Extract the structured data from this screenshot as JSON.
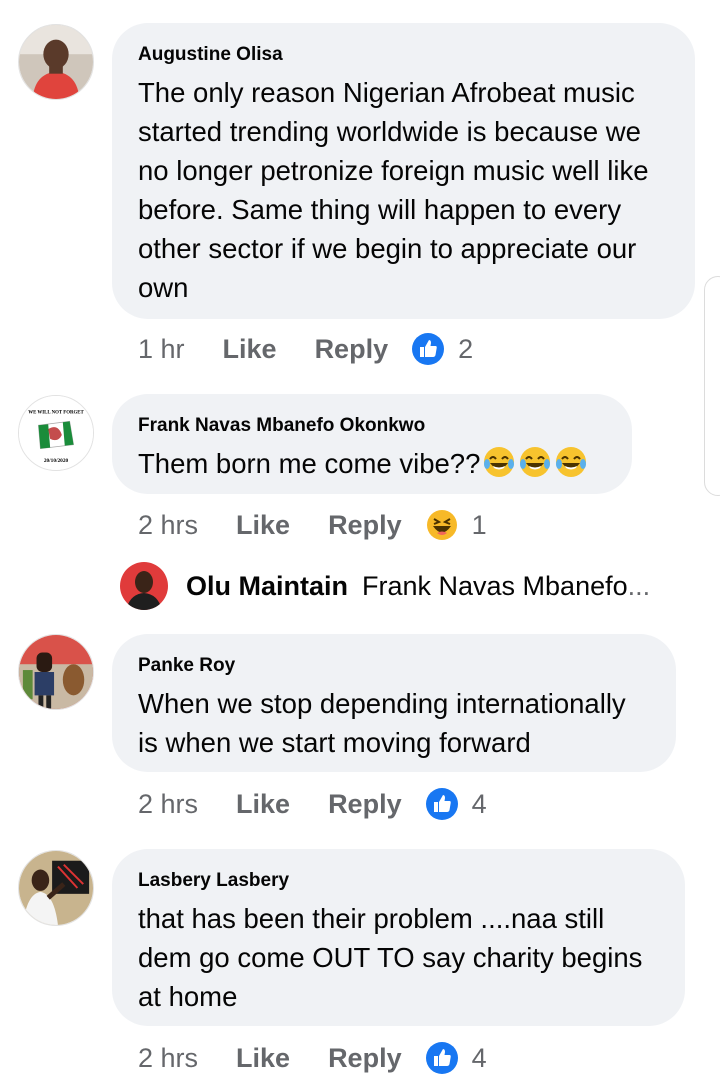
{
  "comments": [
    {
      "author": "Augustine Olisa",
      "text": "The only reason Nigerian Afrobeat music started trending worldwide is because we no longer petronize foreign music well like before. Same thing will happen to every other sector if we begin to appreciate our own",
      "time": "1 hr",
      "like_label": "Like",
      "reply_label": "Reply",
      "reaction": "like-icon",
      "reaction_count": "2"
    },
    {
      "author": "Frank Navas Mbanefo Okonkwo",
      "text": "Them born me come vibe??",
      "emojis": [
        "laughing-tears-emoji",
        "laughing-tears-emoji",
        "laughing-tears-emoji"
      ],
      "avatar_text_top": "WE WILL NOT FORGET",
      "avatar_text_bottom": "20/10/2020",
      "time": "2 hrs",
      "like_label": "Like",
      "reply_label": "Reply",
      "reaction": "haha-icon",
      "reaction_count": "1"
    },
    {
      "author": "Panke Roy",
      "text": "When we stop depending internationally is when we start moving forward",
      "time": "2 hrs",
      "like_label": "Like",
      "reply_label": "Reply",
      "reaction": "like-icon",
      "reaction_count": "4"
    },
    {
      "author": "Lasbery Lasbery",
      "text": "that has been their problem ....naa still dem go come OUT TO say charity begins at home",
      "time": "2 hrs",
      "like_label": "Like",
      "reply_label": "Reply",
      "reaction": "like-icon",
      "reaction_count": "4"
    }
  ],
  "reply_preview": {
    "author": "Olu Maintain",
    "text": "Frank Navas Mbanefo",
    "ellipsis": "..."
  },
  "colors": {
    "bubble": "#f0f2f5",
    "meta_text": "#65676b",
    "like_blue": "#1877f2",
    "haha_yellow": "#f7b928"
  }
}
